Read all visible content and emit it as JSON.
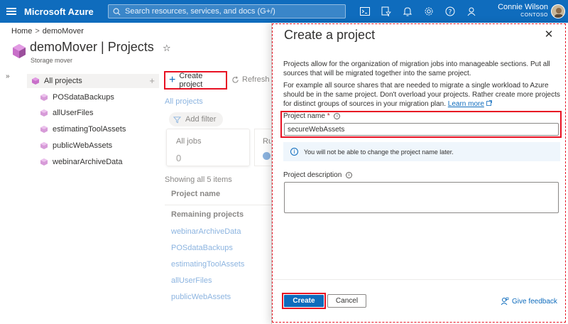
{
  "topbar": {
    "brand": "Microsoft Azure",
    "search_placeholder": "Search resources, services, and docs (G+/)",
    "icons": [
      "cloud-shell-icon",
      "directory-filter-icon",
      "notifications-icon",
      "settings-icon",
      "help-icon",
      "feedback-icon"
    ],
    "user_name": "Connie Wilson",
    "user_org": "CONTOSO"
  },
  "breadcrumb": {
    "home": "Home",
    "current": "demoMover",
    "separator": ">"
  },
  "resource": {
    "title": "demoMover | Projects",
    "subtitle": "Storage mover"
  },
  "sidebar": {
    "all_projects": "All projects",
    "items": [
      {
        "label": "POSdataBackups"
      },
      {
        "label": "allUserFiles"
      },
      {
        "label": "estimatingToolAssets"
      },
      {
        "label": "publicWebAssets"
      },
      {
        "label": "webinarArchiveData"
      }
    ]
  },
  "main": {
    "create_project": "Create project",
    "refresh": "Refresh",
    "all_projects_link": "All projects",
    "add_filter": "Add filter",
    "card_all_jobs": {
      "label": "All jobs",
      "value": "0"
    },
    "card_running": {
      "label": "Ru"
    },
    "showing": "Showing all 5 items",
    "column_header": "Project name",
    "group_header": "Remaining projects",
    "projects": [
      "webinarArchiveData",
      "POSdataBackups",
      "estimatingToolAssets",
      "allUserFiles",
      "publicWebAssets"
    ]
  },
  "panel": {
    "title": "Create a project",
    "desc1": "Projects allow for the organization of migration jobs into manageable sections. Put all sources that will be migrated together into the same project.",
    "desc2": "For example all source shares that are needed to migrate a single workload to Azure should be in the same project. Don't overload your projects. Rather create more projects for distinct groups of sources in your migration plan.",
    "learn_more": "Learn more",
    "name_label": "Project name",
    "name_required": "*",
    "name_value": "secureWebAssets",
    "info_text": "You will not be able to change the project name later.",
    "desc_label": "Project description",
    "desc_value": "",
    "create_button": "Create",
    "cancel_button": "Cancel",
    "feedback": "Give feedback"
  },
  "colors": {
    "accent": "#0f6cbd",
    "highlight": "#e81123"
  }
}
